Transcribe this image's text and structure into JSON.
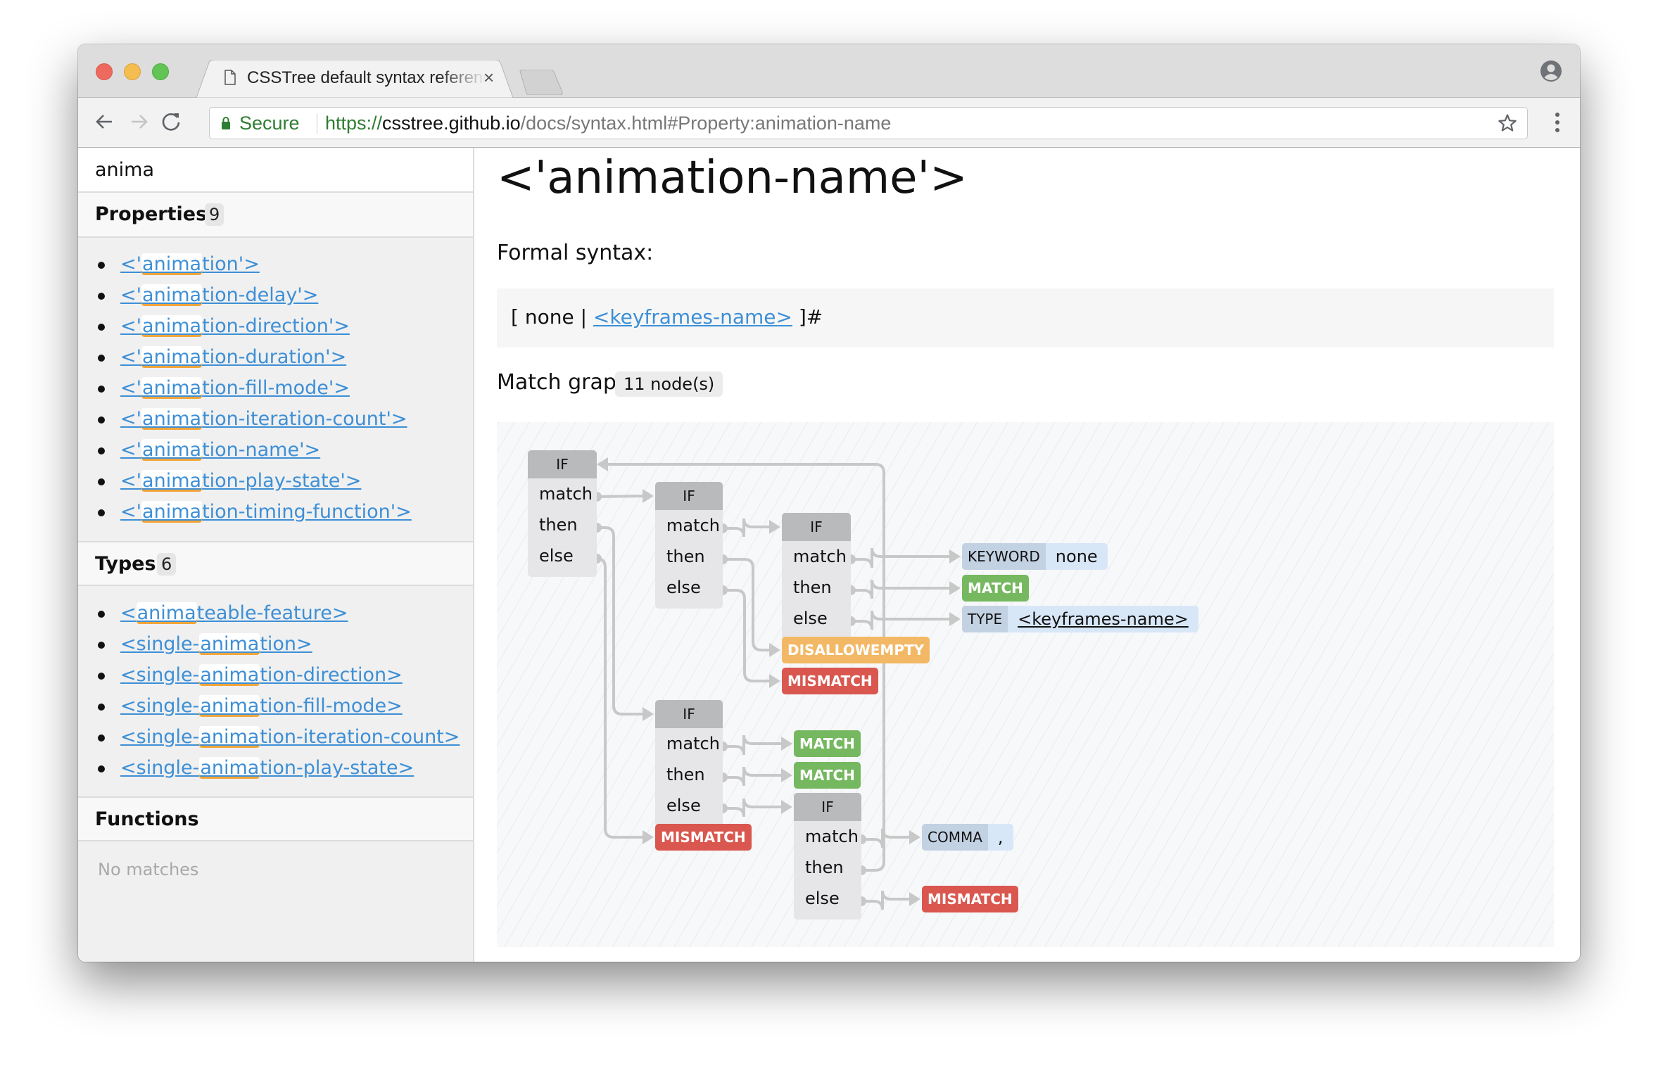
{
  "browser": {
    "tab_title": "CSSTree default syntax reference",
    "tab_close": "×",
    "icons": {
      "page": "document-icon",
      "profile": "profile-icon",
      "back": "back-arrow-icon",
      "forward": "forward-arrow-icon",
      "reload": "reload-icon",
      "lock": "lock-icon",
      "star": "star-icon",
      "menu": "kebab-menu-icon"
    },
    "secure_label": "Secure",
    "url": {
      "scheme": "https://",
      "host": "csstree.github.io",
      "path": "/docs/syntax.html#Property:animation-name"
    }
  },
  "sidebar": {
    "search_value": "anima",
    "highlight": "anima",
    "sections": [
      {
        "title": "Properties",
        "count": "9",
        "items": [
          {
            "pre": "<'",
            "hl": "anima",
            "post": "tion'>"
          },
          {
            "pre": "<'",
            "hl": "anima",
            "post": "tion-delay'>"
          },
          {
            "pre": "<'",
            "hl": "anima",
            "post": "tion-direction'>"
          },
          {
            "pre": "<'",
            "hl": "anima",
            "post": "tion-duration'>"
          },
          {
            "pre": "<'",
            "hl": "anima",
            "post": "tion-fill-mode'>"
          },
          {
            "pre": "<'",
            "hl": "anima",
            "post": "tion-iteration-count'>"
          },
          {
            "pre": "<'",
            "hl": "anima",
            "post": "tion-name'>"
          },
          {
            "pre": "<'",
            "hl": "anima",
            "post": "tion-play-state'>"
          },
          {
            "pre": "<'",
            "hl": "anima",
            "post": "tion-timing-function'>"
          }
        ]
      },
      {
        "title": "Types",
        "count": "6",
        "items": [
          {
            "pre": "<",
            "hl": "anima",
            "post": "teable-feature>"
          },
          {
            "pre": "<single-",
            "hl": "anima",
            "post": "tion>"
          },
          {
            "pre": "<single-",
            "hl": "anima",
            "post": "tion-direction>"
          },
          {
            "pre": "<single-",
            "hl": "anima",
            "post": "tion-fill-mode>"
          },
          {
            "pre": "<single-",
            "hl": "anima",
            "post": "tion-iteration-count>"
          },
          {
            "pre": "<single-",
            "hl": "anima",
            "post": "tion-play-state>"
          }
        ]
      },
      {
        "title": "Functions",
        "count": null,
        "items": [],
        "empty_text": "No matches"
      }
    ]
  },
  "main": {
    "title": "<'animation-name'>",
    "formal_syntax_label": "Formal syntax:",
    "syntax": {
      "before": "[ none | ",
      "link": "<keyframes-name>",
      "after": " ]#"
    },
    "match_graph_label": "Match graph:",
    "node_count": "11 node(s)",
    "graph": {
      "if_label": "IF",
      "row_labels": [
        "match",
        "then",
        "else"
      ],
      "colors": {
        "match": "#75b85f",
        "mismatch": "#d9574f",
        "disallow_empty": "#f3b865",
        "token_kind_bg": "#c3d2e3",
        "token_bg": "#d8e7f7",
        "if_header": "#b9babb",
        "if_body": "#e6e6e8",
        "edge": "#c8c8c8"
      },
      "nodes": [
        {
          "id": "if1",
          "type": "IF"
        },
        {
          "id": "if2",
          "type": "IF"
        },
        {
          "id": "if3",
          "type": "IF"
        },
        {
          "id": "kw",
          "type": "KEYWORD",
          "kind": "KEYWORD",
          "value": "none"
        },
        {
          "id": "match1",
          "type": "MATCH",
          "label": "MATCH"
        },
        {
          "id": "type1",
          "type": "TYPE",
          "kind": "TYPE",
          "value": "<keyframes-name>"
        },
        {
          "id": "disallow",
          "type": "DISALLOWEMPTY",
          "label": "DISALLOWEMPTY"
        },
        {
          "id": "mismatch1",
          "type": "MISMATCH",
          "label": "MISMATCH"
        },
        {
          "id": "if4",
          "type": "IF"
        },
        {
          "id": "match2",
          "type": "MATCH",
          "label": "MATCH"
        },
        {
          "id": "match3",
          "type": "MATCH",
          "label": "MATCH"
        },
        {
          "id": "if5",
          "type": "IF"
        },
        {
          "id": "mismatch2",
          "type": "MISMATCH",
          "label": "MISMATCH"
        },
        {
          "id": "comma",
          "type": "COMMA",
          "kind": "COMMA",
          "value": ","
        },
        {
          "id": "mismatch3",
          "type": "MISMATCH",
          "label": "MISMATCH"
        }
      ],
      "edges": [
        {
          "from": "if1.match",
          "to": "if2"
        },
        {
          "from": "if1.then",
          "to": "if4"
        },
        {
          "from": "if1.else",
          "to": "mismatch2"
        },
        {
          "from": "if2.match",
          "to": "if3"
        },
        {
          "from": "if2.then",
          "to": "disallow"
        },
        {
          "from": "if2.else",
          "to": "mismatch1"
        },
        {
          "from": "if3.match",
          "to": "kw"
        },
        {
          "from": "if3.then",
          "to": "match1"
        },
        {
          "from": "if3.else",
          "to": "type1"
        },
        {
          "from": "if4.match",
          "to": "match2"
        },
        {
          "from": "if4.then",
          "to": "match3"
        },
        {
          "from": "if4.else",
          "to": "if5"
        },
        {
          "from": "if5.match",
          "to": "comma"
        },
        {
          "from": "if5.then",
          "to": "if1"
        },
        {
          "from": "if5.else",
          "to": "mismatch3"
        }
      ]
    }
  }
}
